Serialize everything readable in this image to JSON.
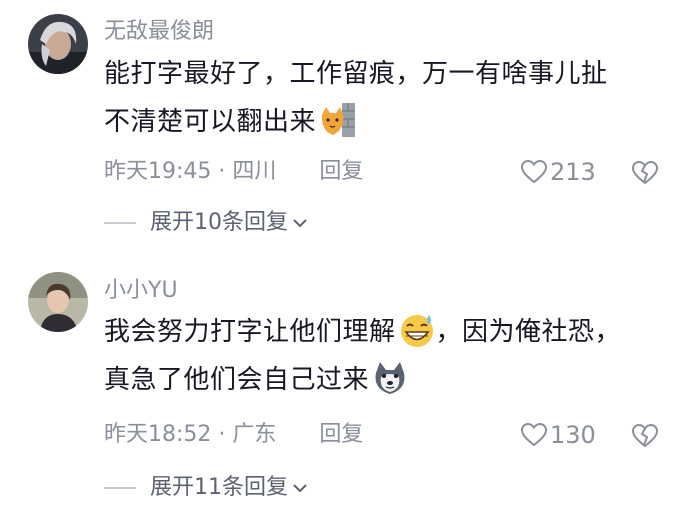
{
  "comments": [
    {
      "username": "无敌最俊朗",
      "lines": [
        "能打字最好了，工作留痕，万一有啥事儿扯",
        "不清楚可以翻出来"
      ],
      "emoji": "cat-peek-emoji",
      "time": "昨天19:45",
      "location": "四川",
      "reply_label": "回复",
      "likes": "213",
      "expand_label": "展开10条回复"
    },
    {
      "username": "小小YU",
      "lines": [
        "我会努力打字让他们理解",
        "，因为俺社恐，",
        "真急了他们会自己过来"
      ],
      "emoji_inline": "laughing-sweat-emoji",
      "emoji_end": "husky-dog-emoji",
      "time": "昨天18:52",
      "location": "广东",
      "reply_label": "回复",
      "likes": "130",
      "expand_label": "展开11条回复"
    }
  ],
  "colors": {
    "text": "#161823",
    "secondary": "#8a8f99",
    "expand": "#5d6270"
  },
  "icons": [
    "heart-outline-icon",
    "broken-heart-icon",
    "chevron-down-icon"
  ]
}
